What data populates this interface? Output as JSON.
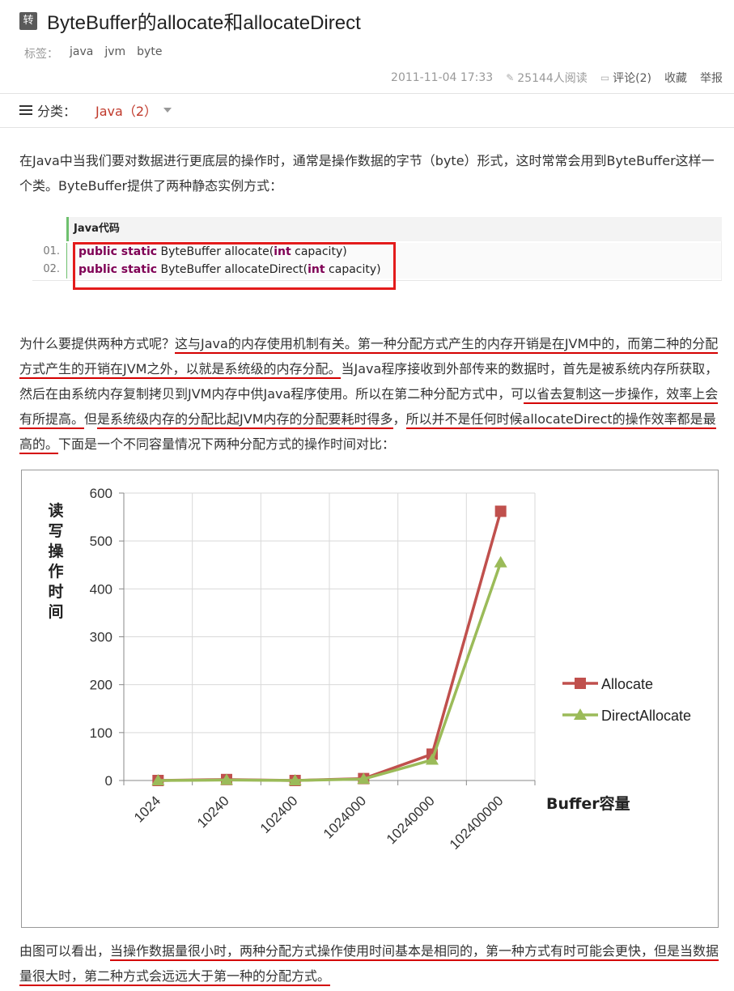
{
  "article": {
    "badge": "转",
    "title": "ByteBuffer的allocate和allocateDirect",
    "tags_label": "标签：",
    "tags": [
      "java",
      "jvm",
      "byte"
    ],
    "date": "2011-11-04 17:33",
    "reads": "25144人阅读",
    "comments": "评论(2)",
    "favorite": "收藏",
    "report": "举报",
    "category_label": "分类：",
    "category": "Java（2）"
  },
  "content": {
    "para1": "在Java中当我们要对数据进行更底层的操作时，通常是操作数据的字节（byte）形式，这时常常会用到ByteBuffer这样一个类。ByteBuffer提供了两种静态实例方式：",
    "code_title": "Java代码",
    "code_lines": [
      {
        "no": "01.",
        "kw": "public static",
        "rest_a": " ByteBuffer allocate(",
        "kw2": "int",
        "rest_b": " capacity)"
      },
      {
        "no": "02.",
        "kw": "public static",
        "rest_a": " ByteBuffer allocateDirect(",
        "kw2": "int",
        "rest_b": " capacity)"
      }
    ],
    "para2_a": "为什么要提供两种方式呢？",
    "para2_b": "这与Java的内存使用机制有关。第一种分配方式产生的内存开销是在JVM中的，而第二种的分配方式产生的开销在JVM之外，以就是系统级的内存分配。",
    "para2_c": "当Java程序接收到外部传来的数据时，首先是被系统内存所获取，然后在由系统内存复制拷贝到JVM内存中供Java程序使用。所以在第二种分配方式中，可",
    "para2_d": "以省去复制这一步操作，效率上会有所提高。",
    "para2_e": "但",
    "para2_f": "是系统级内存的分配比起JVM内存的分配要耗时得多",
    "para2_g": "，",
    "para2_h": "所以并不是任何时候allocateDirect的操作效率都是最高的。",
    "para2_i": "下面是一个不同容量情况下两种分配方式的操作时间对比：",
    "para3_a": "由图可以看出，",
    "para3_b": "当操作数据量很小时，两种分配方式操作使用时间基本是相同的，第一种方式有时可能会更快，但是当数据量很大时，第二种方式会远远大于第一种的分配方式。"
  },
  "chart_data": {
    "type": "line",
    "title": "",
    "ylabel": "读写操作时间",
    "xlabel": "Buffer容量",
    "categories": [
      "1024",
      "10240",
      "102400",
      "1024000",
      "10240000",
      "102400000"
    ],
    "ylim": [
      0,
      600
    ],
    "yticks": [
      "0",
      "100",
      "200",
      "300",
      "400",
      "500",
      "600"
    ],
    "grid": true,
    "legend_position": "right",
    "series": [
      {
        "name": "Allocate",
        "color": "#c0504d",
        "marker": "square",
        "values": [
          0,
          2,
          0,
          4,
          55,
          562
        ]
      },
      {
        "name": "DirectAllocate",
        "color": "#9bbb59",
        "marker": "triangle",
        "values": [
          0,
          1,
          0,
          3,
          43,
          455
        ]
      }
    ]
  }
}
